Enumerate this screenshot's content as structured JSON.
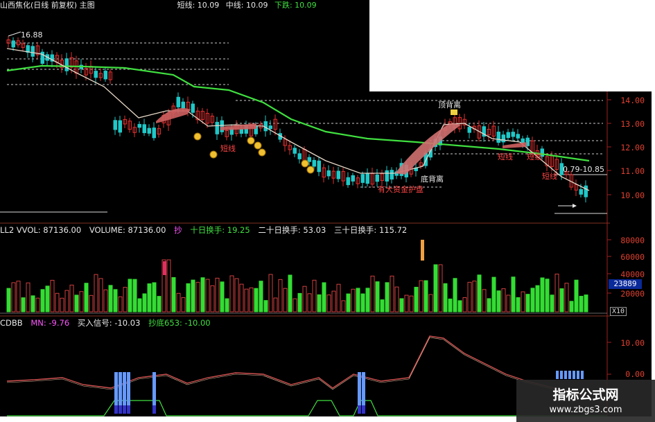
{
  "title_bar": {
    "stock_name": "山西焦化(日线 前复权) 主图",
    "short_label": "短线: 10.09",
    "mid_label": "中线: 10.09",
    "down_label": "下跌: 10.09"
  },
  "price_panel": {
    "high_marker": "16.88",
    "range_marker": "0.79-10.85",
    "y_ticks": [
      "14.00",
      "13.00",
      "12.00",
      "11.00",
      "10.00"
    ],
    "annotations": {
      "short_line": "短线",
      "top_divergence": "顶背离",
      "bottom_divergence": "底背离",
      "short_line_2": "短线",
      "short_line_3": "短线",
      "short_line_4": "短线",
      "bottom_text": "有大资金护盘"
    }
  },
  "volume_panel": {
    "header": {
      "indicator": "LL2 VVOL: 87136.00",
      "volume": "VOLUME: 87136.00",
      "sell": "抄",
      "ten_day": "十日换手: 19.25",
      "twenty_day": "二十日换手: 53.03",
      "thirty_day": "三十日换手: 115.72"
    },
    "y_ticks": [
      "80000",
      "60000",
      "40000",
      "20000"
    ],
    "current_value": "23889",
    "scale_label": "X10"
  },
  "indicator_panel": {
    "header": {
      "name": "CDBB",
      "mn": "MN: -9.76",
      "buy_signal": "买入信号: -10.03",
      "bottom": "抄底653: -10.00"
    },
    "y_ticks": [
      "10.00",
      "0.00"
    ]
  },
  "watermark": {
    "cn": "指标公式网",
    "url": "www.zbgs3.com"
  },
  "colors": {
    "up": "#e03030",
    "down": "#20c8c8",
    "vol_up": "#d04040",
    "vol_down": "#33dd33",
    "ma_green": "#40e040",
    "ma_white": "#e8e8e8",
    "axis": "#e04030",
    "signal_blue": "#6699ff"
  }
}
